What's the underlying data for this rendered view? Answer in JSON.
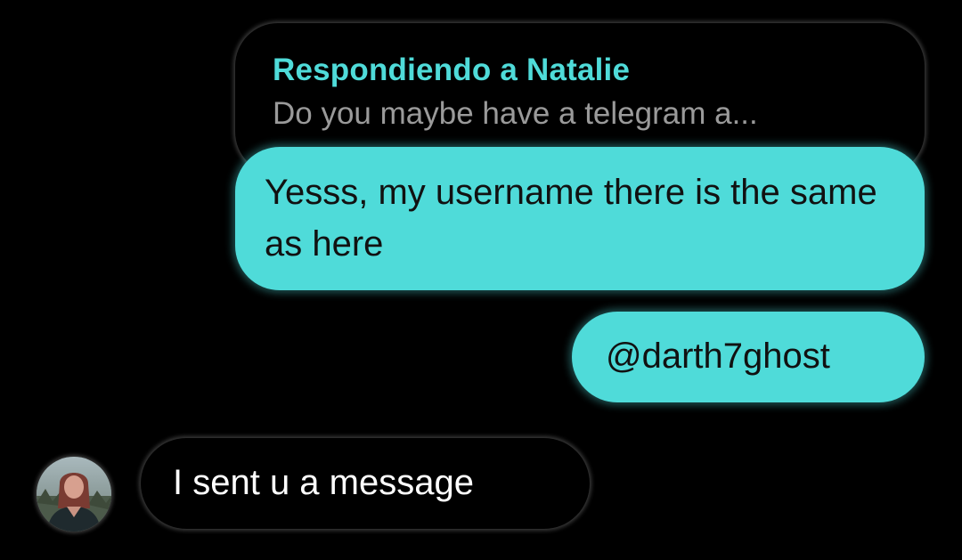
{
  "reply_preview": {
    "name": "Respondiendo a Natalie",
    "text": "Do you maybe have a telegram a..."
  },
  "messages": [
    {
      "direction": "outgoing",
      "text": "Yesss, my username there is the same as here"
    },
    {
      "direction": "outgoing",
      "text": "@darth7ghost"
    },
    {
      "direction": "incoming",
      "text": "I sent u a message"
    }
  ],
  "avatar": {
    "icon": "user-avatar-photo"
  },
  "colors": {
    "background": "#000000",
    "accent": "#4fdbd9",
    "reply_text": "#9a9a9a",
    "incoming_text": "#ffffff"
  }
}
